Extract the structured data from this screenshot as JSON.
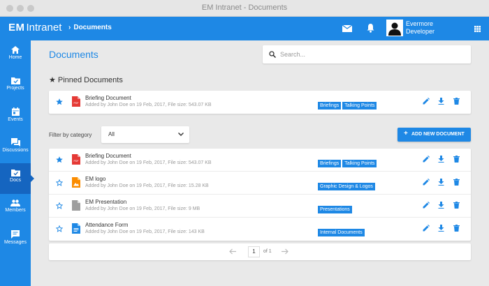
{
  "window": {
    "title": "EM Intranet - Documents"
  },
  "header": {
    "logo_mark": "EM",
    "logo_text": "Intranet",
    "breadcrumb": "Documents",
    "user": {
      "name_line1": "Evermore",
      "name_line2": "Developer"
    },
    "icons": [
      "mail-icon",
      "bell-icon",
      "apps-grid-icon"
    ]
  },
  "sidebar": {
    "items": [
      {
        "label": "Home",
        "icon": "home-icon"
      },
      {
        "label": "Projects",
        "icon": "folder-check-icon"
      },
      {
        "label": "Events",
        "icon": "calendar-icon"
      },
      {
        "label": "Discussions",
        "icon": "chat-icon"
      },
      {
        "label": "Docs",
        "icon": "docs-folder-icon",
        "active": true
      },
      {
        "label": "Members",
        "icon": "people-icon"
      },
      {
        "label": "Messages",
        "icon": "message-icon"
      }
    ]
  },
  "main": {
    "title": "Documents",
    "search": {
      "placeholder": "Search..."
    },
    "pinned": {
      "heading": "Pinned Documents",
      "rows": [
        {
          "name": "Briefing Document",
          "meta": "Added by John Doe on 19 Feb, 2017, File size: 543.07 KB",
          "type": "pdf",
          "starred": true,
          "tags": [
            "Briefings",
            "Talking Points"
          ]
        }
      ]
    },
    "filter": {
      "label": "Filter by category",
      "selected": "All"
    },
    "add_button": {
      "label": "ADD NEW DOCUMENT"
    },
    "documents": [
      {
        "name": "Briefing Document",
        "meta": "Added by John Doe on 19 Feb, 2017, File size: 543.07 KB",
        "type": "pdf",
        "starred": true,
        "tags": [
          "Briefings",
          "Talking Points"
        ]
      },
      {
        "name": "EM logo",
        "meta": "Added by John Doe on 19 Feb, 2017, File size: 15.28 KB",
        "type": "image",
        "starred": false,
        "tags": [
          "Graphic Design & Logos"
        ]
      },
      {
        "name": "EM Presentation",
        "meta": "Added by John Doe on 19 Feb, 2017, File size: 9 MB",
        "type": "presentation",
        "starred": false,
        "tags": [
          "Presentations"
        ]
      },
      {
        "name": "Attendance Form",
        "meta": "Added by John Doe on 19 Feb, 2017, File size: 143 KB",
        "type": "doc",
        "starred": false,
        "tags": [
          "Internal Documents"
        ]
      }
    ],
    "pagination": {
      "current": "1",
      "of_label": "of 1"
    }
  },
  "colors": {
    "primary": "#1e88e5",
    "primary_dark": "#1565c0",
    "pdf": "#e53935",
    "image": "#fb8c00",
    "presentation": "#9e9e9e",
    "doc": "#1e88e5"
  }
}
